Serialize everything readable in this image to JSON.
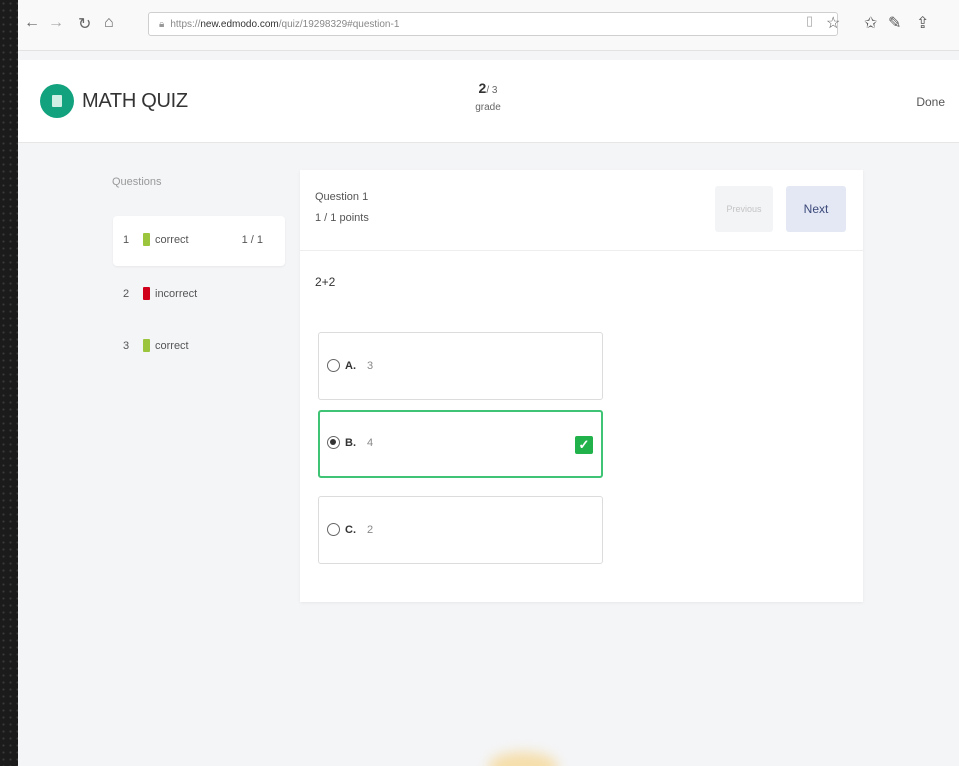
{
  "browser": {
    "url_prefix": "https://",
    "url_host": "new.edmodo.com",
    "url_path": "/quiz/19298329#question-1"
  },
  "header": {
    "title": "MATH QUIZ",
    "score": "2",
    "score_total": "/ 3",
    "score_label": "grade",
    "done_label": "Done"
  },
  "sidebar": {
    "heading": "Questions",
    "items": [
      {
        "num": "1",
        "status": "correct",
        "points": "1 / 1",
        "color": "#9bc53d"
      },
      {
        "num": "2",
        "status": "incorrect",
        "points": "",
        "color": "#d0021b"
      },
      {
        "num": "3",
        "status": "correct",
        "points": "",
        "color": "#9bc53d"
      }
    ]
  },
  "question": {
    "title": "Question 1",
    "points": "1 / 1 points",
    "previous_label": "Previous",
    "next_label": "Next",
    "text": "2+2",
    "options": [
      {
        "letter": "A.",
        "value": "3",
        "selected": false
      },
      {
        "letter": "B.",
        "value": "4",
        "selected": true,
        "correct": true
      },
      {
        "letter": "C.",
        "value": "2",
        "selected": false
      }
    ]
  },
  "colors": {
    "brand": "#12a27e",
    "correct_border": "#3fc374",
    "correct_badge": "#22b24c"
  },
  "icons": [
    "back-arrow-icon",
    "forward-arrow-icon",
    "reload-icon",
    "home-icon",
    "lock-icon",
    "reader-icon",
    "star-icon",
    "favorites-icon",
    "pen-icon",
    "share-icon"
  ]
}
